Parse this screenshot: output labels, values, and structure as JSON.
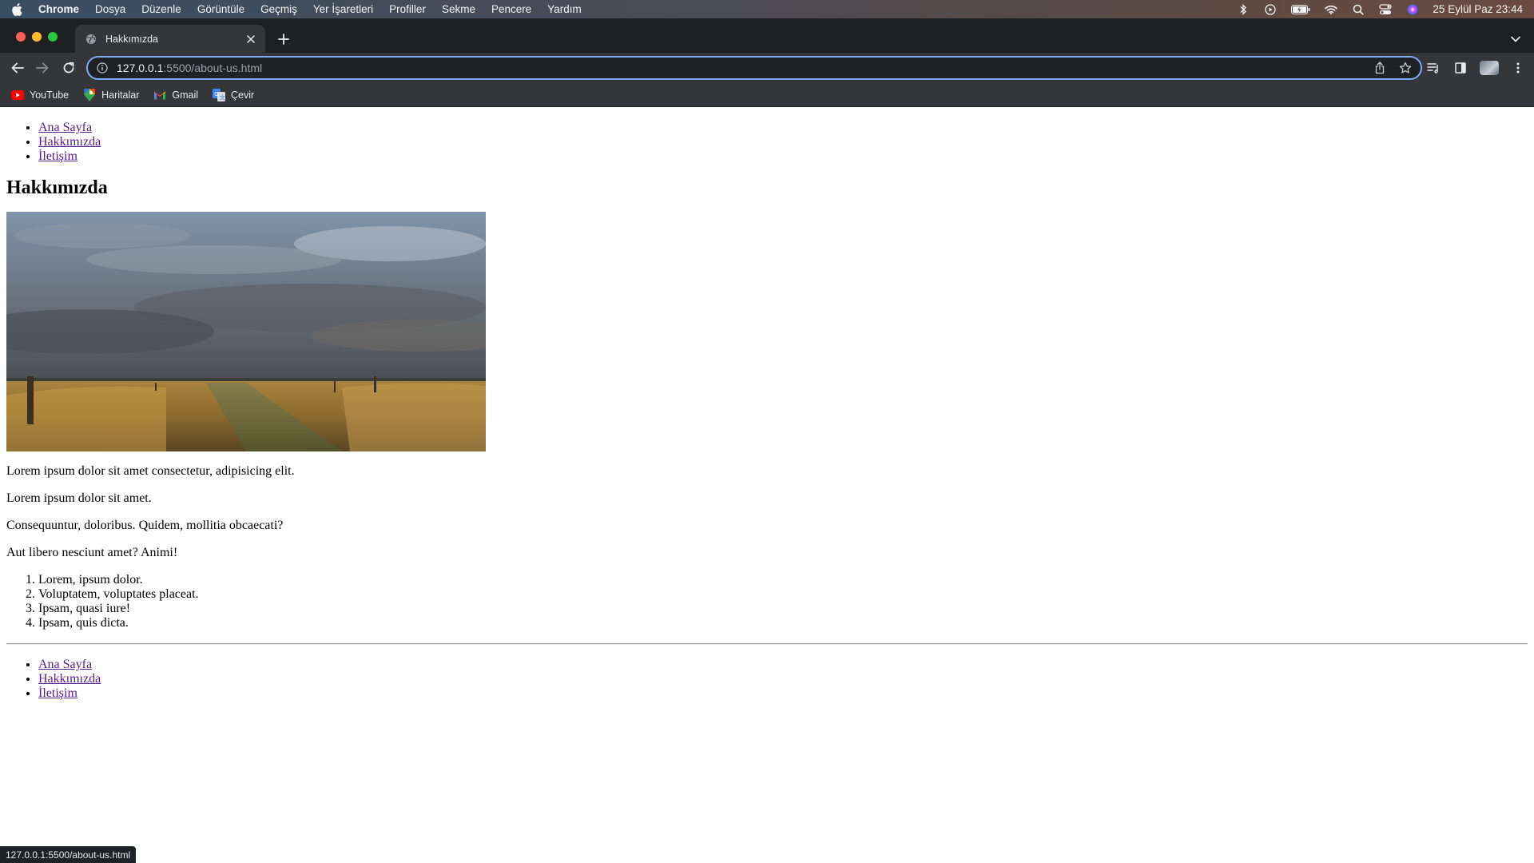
{
  "menubar": {
    "app_name": "Chrome",
    "items": [
      "Dosya",
      "Düzenle",
      "Görüntüle",
      "Geçmiş",
      "Yer İşaretleri",
      "Profiller",
      "Sekme",
      "Pencere",
      "Yardım"
    ],
    "clock": "25 Eylül Paz  23:44",
    "status_icons": [
      "bluetooth-icon",
      "play-icon",
      "battery-icon",
      "wifi-icon",
      "spotlight-search-icon",
      "control-center-icon",
      "siri-icon"
    ]
  },
  "tab": {
    "title": "Hakkımızda"
  },
  "omnibox": {
    "url_host": "127.0.0.1",
    "url_path": ":5500/about-us.html"
  },
  "bookmarks": [
    {
      "label": "YouTube",
      "icon": "youtube-icon"
    },
    {
      "label": "Haritalar",
      "icon": "maps-icon"
    },
    {
      "label": "Gmail",
      "icon": "gmail-icon"
    },
    {
      "label": "Çevir",
      "icon": "translate-icon"
    }
  ],
  "page": {
    "nav": [
      "Ana Sayfa",
      "Hakkımızda",
      "İletişim"
    ],
    "heading": "Hakkımızda",
    "paragraphs": [
      "Lorem ipsum dolor sit amet consectetur, adipisicing elit.",
      "Lorem ipsum dolor sit amet.",
      "Consequuntur, doloribus. Quidem, mollitia obcaecati?",
      "Aut libero nesciunt amet? Animi!"
    ],
    "ordered_list": [
      "Lorem, ipsum dolor.",
      "Voluptatem, voluptates placeat.",
      "Ipsam, quasi iure!",
      "Ipsam, quis dicta."
    ],
    "footer_nav": [
      "Ana Sayfa",
      "Hakkımızda",
      "İletişim"
    ]
  },
  "statusbar": {
    "text": "127.0.0.1:5500/about-us.html"
  },
  "colors": {
    "link_visited": "#551a8b",
    "omnibox_focus": "#7cacf8",
    "chrome_dark": "#35363a"
  }
}
